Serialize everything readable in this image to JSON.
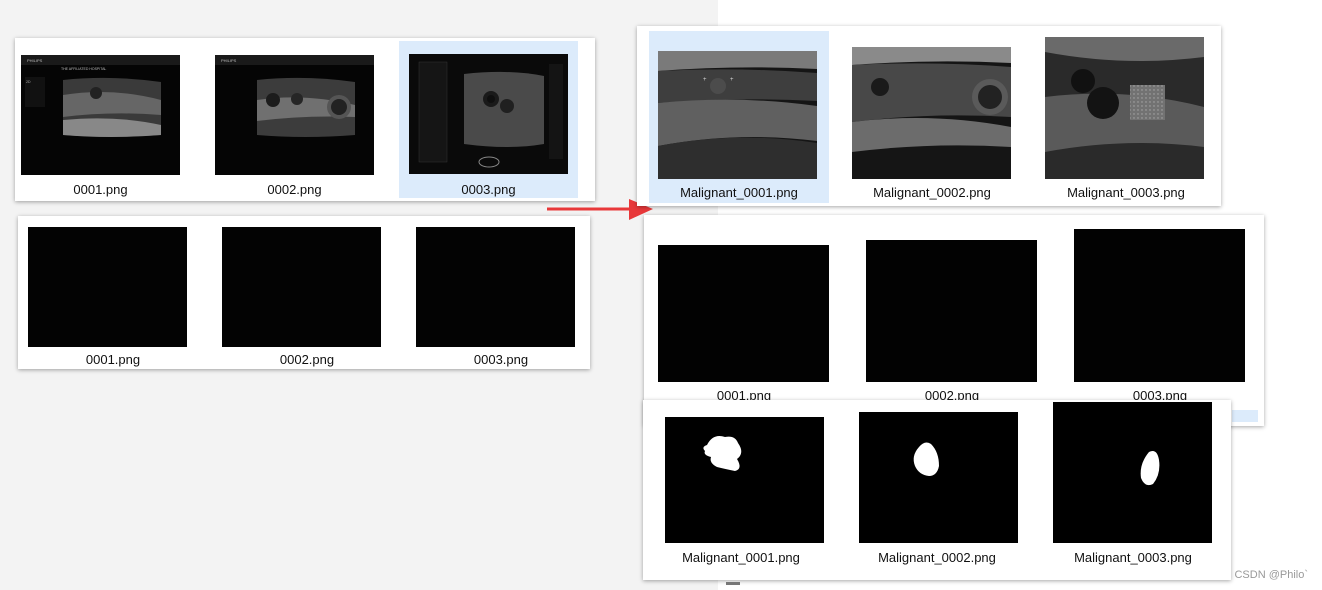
{
  "source_top": {
    "files": [
      {
        "name": "0001.png",
        "selected": false
      },
      {
        "name": "0002.png",
        "selected": false
      },
      {
        "name": "0003.png",
        "selected": true
      }
    ]
  },
  "source_masks": {
    "files": [
      {
        "name": "0001.png"
      },
      {
        "name": "0002.png"
      },
      {
        "name": "0003.png"
      }
    ]
  },
  "target_images": {
    "files": [
      {
        "name": "Malignant_0001.png",
        "selected": true
      },
      {
        "name": "Malignant_0002.png",
        "selected": false
      },
      {
        "name": "Malignant_0003.png",
        "selected": false
      }
    ]
  },
  "target_masks_dark": {
    "files": [
      {
        "name": "0001.png"
      },
      {
        "name": "0002.png"
      },
      {
        "name": "0003.png"
      }
    ]
  },
  "target_masks": {
    "files": [
      {
        "name": "Malignant_0001.png"
      },
      {
        "name": "Malignant_0002.png"
      },
      {
        "name": "Malignant_0003.png"
      }
    ]
  },
  "arrow": {
    "color": "#e8383a",
    "icon": "right-arrow-icon"
  },
  "watermark": "CSDN @Philo`"
}
